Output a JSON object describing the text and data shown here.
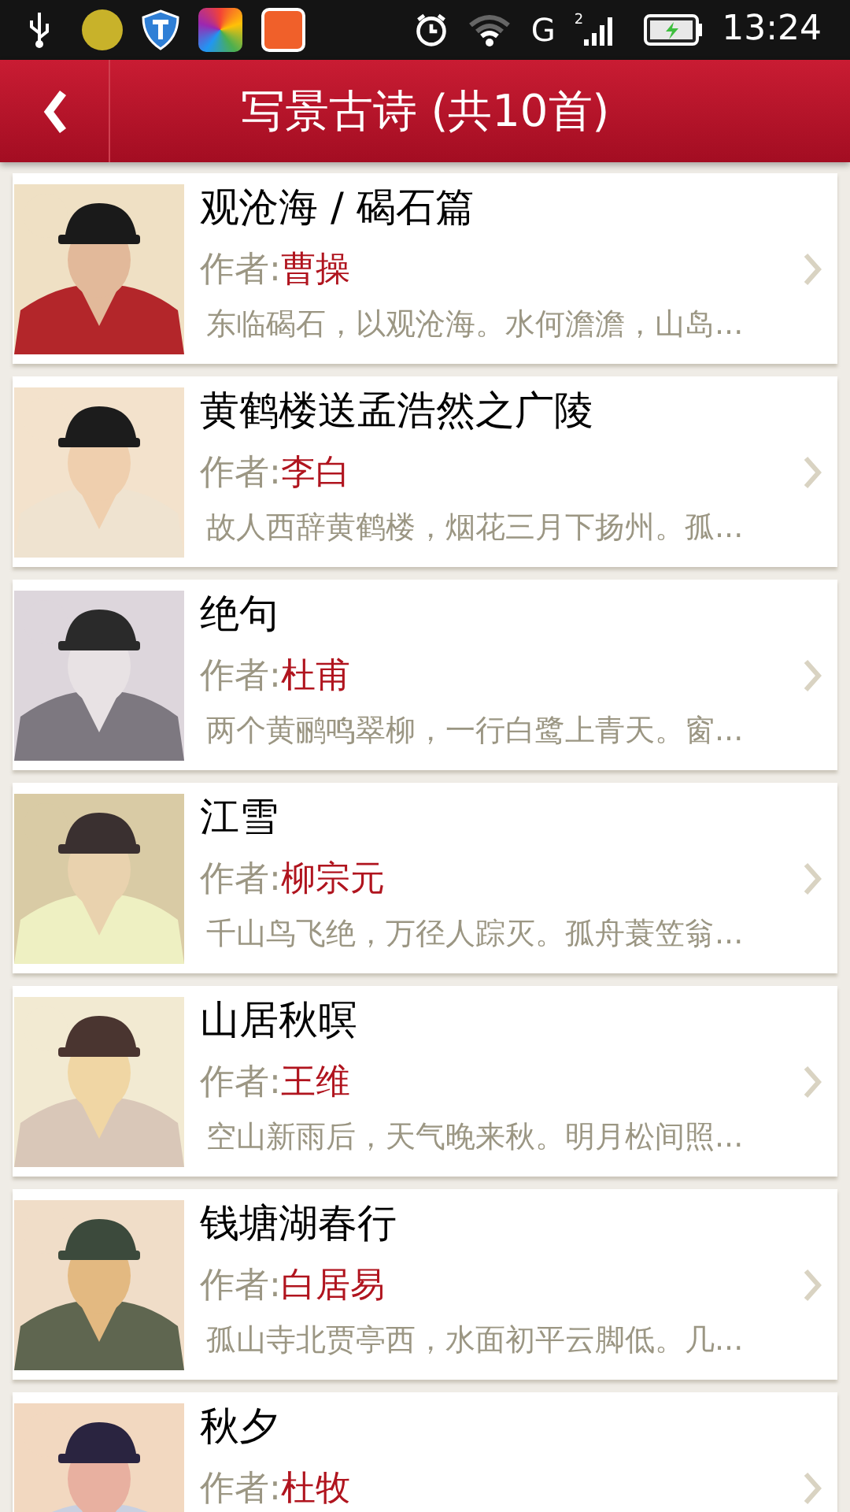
{
  "status_bar": {
    "network": "G",
    "sim": "2",
    "time": "13:24"
  },
  "header": {
    "title": "写景古诗 (共10首)"
  },
  "poems": [
    {
      "title": "观沧海 / 碣石篇",
      "author_label": "作者:",
      "author": "曹操",
      "excerpt": "东临碣石，以观沧海。水何澹澹，山岛..."
    },
    {
      "title": "黄鹤楼送孟浩然之广陵",
      "author_label": "作者:",
      "author": "李白",
      "excerpt": "故人西辞黄鹤楼，烟花三月下扬州。孤..."
    },
    {
      "title": "绝句",
      "author_label": "作者:",
      "author": "杜甫",
      "excerpt": "两个黄鹂鸣翠柳，一行白鹭上青天。窗..."
    },
    {
      "title": "江雪",
      "author_label": "作者:",
      "author": "柳宗元",
      "excerpt": "千山鸟飞绝，万径人踪灭。孤舟蓑笠翁..."
    },
    {
      "title": "山居秋暝",
      "author_label": "作者:",
      "author": "王维",
      "excerpt": "空山新雨后，天气晚来秋。明月松间照..."
    },
    {
      "title": "钱塘湖春行",
      "author_label": "作者:",
      "author": "白居易",
      "excerpt": "孤山寺北贾亭西，水面初平云脚低。几..."
    },
    {
      "title": "秋夕",
      "author_label": "作者:",
      "author": "杜牧"
    }
  ]
}
